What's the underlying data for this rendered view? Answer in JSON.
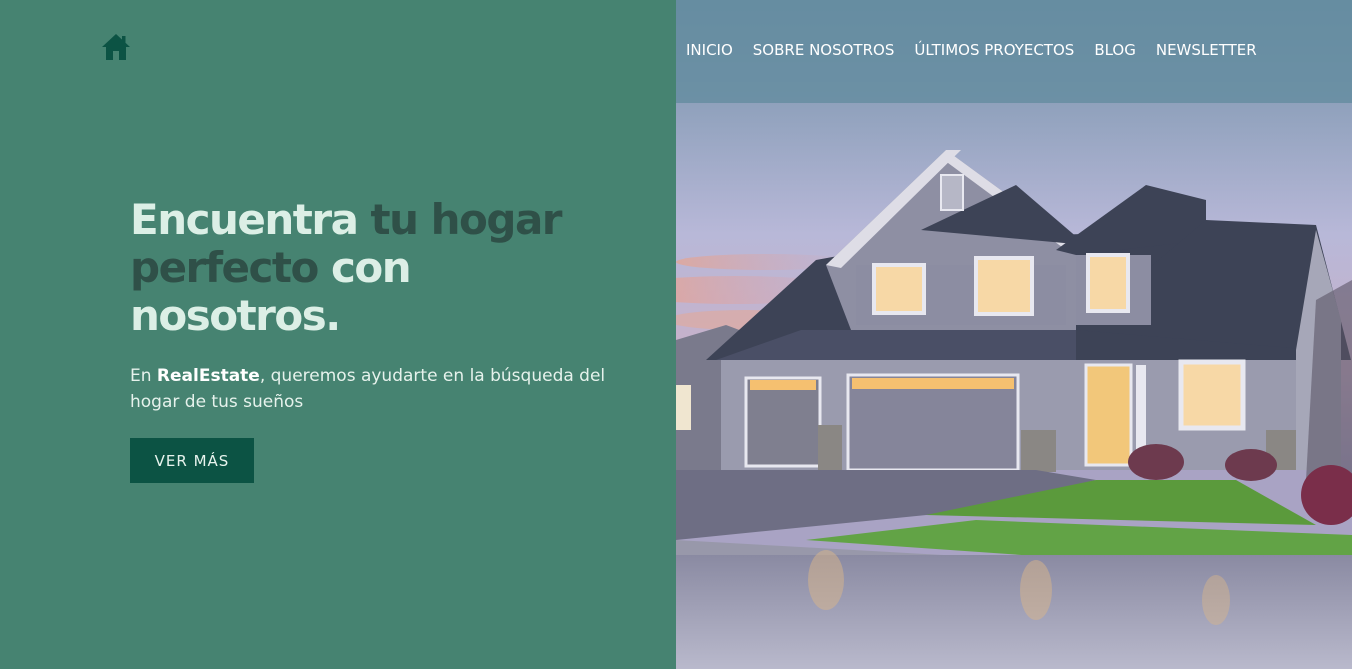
{
  "nav": {
    "items": [
      {
        "label": "INICIO"
      },
      {
        "label": "SOBRE NOSOTROS"
      },
      {
        "label": "ÚLTIMOS PROYECTOS"
      },
      {
        "label": "BLOG"
      },
      {
        "label": "NEWSLETTER"
      }
    ]
  },
  "hero": {
    "title_part1": "Encuentra ",
    "title_part2": "tu hogar perfecto ",
    "title_part3": "con nosotros.",
    "desc_prefix": "En ",
    "desc_brand": "RealEstate",
    "desc_suffix": ", queremos ayudarte en la búsqueda del hogar de tus sueños",
    "cta_label": "VER MÁS"
  },
  "colors": {
    "panel_green": "#468371",
    "button_green": "#0c5344",
    "title_light": "#dcefe6",
    "title_dark": "#2f5048",
    "logo_green": "#0c5344"
  },
  "icons": {
    "logo": "house-icon"
  }
}
